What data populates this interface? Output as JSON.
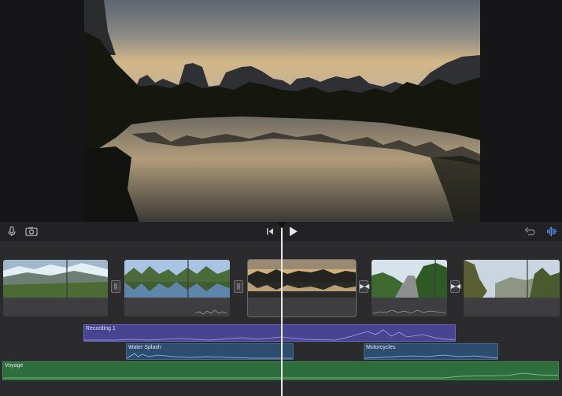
{
  "viewer": {
    "preview_description_icon": "video-preview"
  },
  "toolbar": {
    "left_icons": [
      "microphone-icon",
      "camera-icon"
    ],
    "center_icons": [
      "skip-to-start-icon",
      "play-icon"
    ],
    "right_icons": [
      "undo-icon",
      "audio-waveform-icon"
    ],
    "accent_color": "#4f8ff7"
  },
  "timeline": {
    "clips": [
      {
        "name": "clip-1",
        "scene": "mountains-meadow"
      },
      {
        "name": "clip-2",
        "scene": "karst-river"
      },
      {
        "name": "clip-3",
        "scene": "sunset-river"
      },
      {
        "name": "clip-4",
        "scene": "road-trees"
      },
      {
        "name": "clip-5",
        "scene": "cliffs-valley"
      }
    ],
    "transitions": [
      "cross-dissolve",
      "cross-dissolve",
      "cut",
      "cut"
    ],
    "audio_tracks": {
      "recording": "Recording 1",
      "water": "Water Splash",
      "moto": "Motorcycles",
      "music": "Voyage"
    },
    "colors": {
      "recording": "#48448f",
      "sound_effect": "#2e4c6e",
      "music": "#2d6e3c"
    }
  }
}
